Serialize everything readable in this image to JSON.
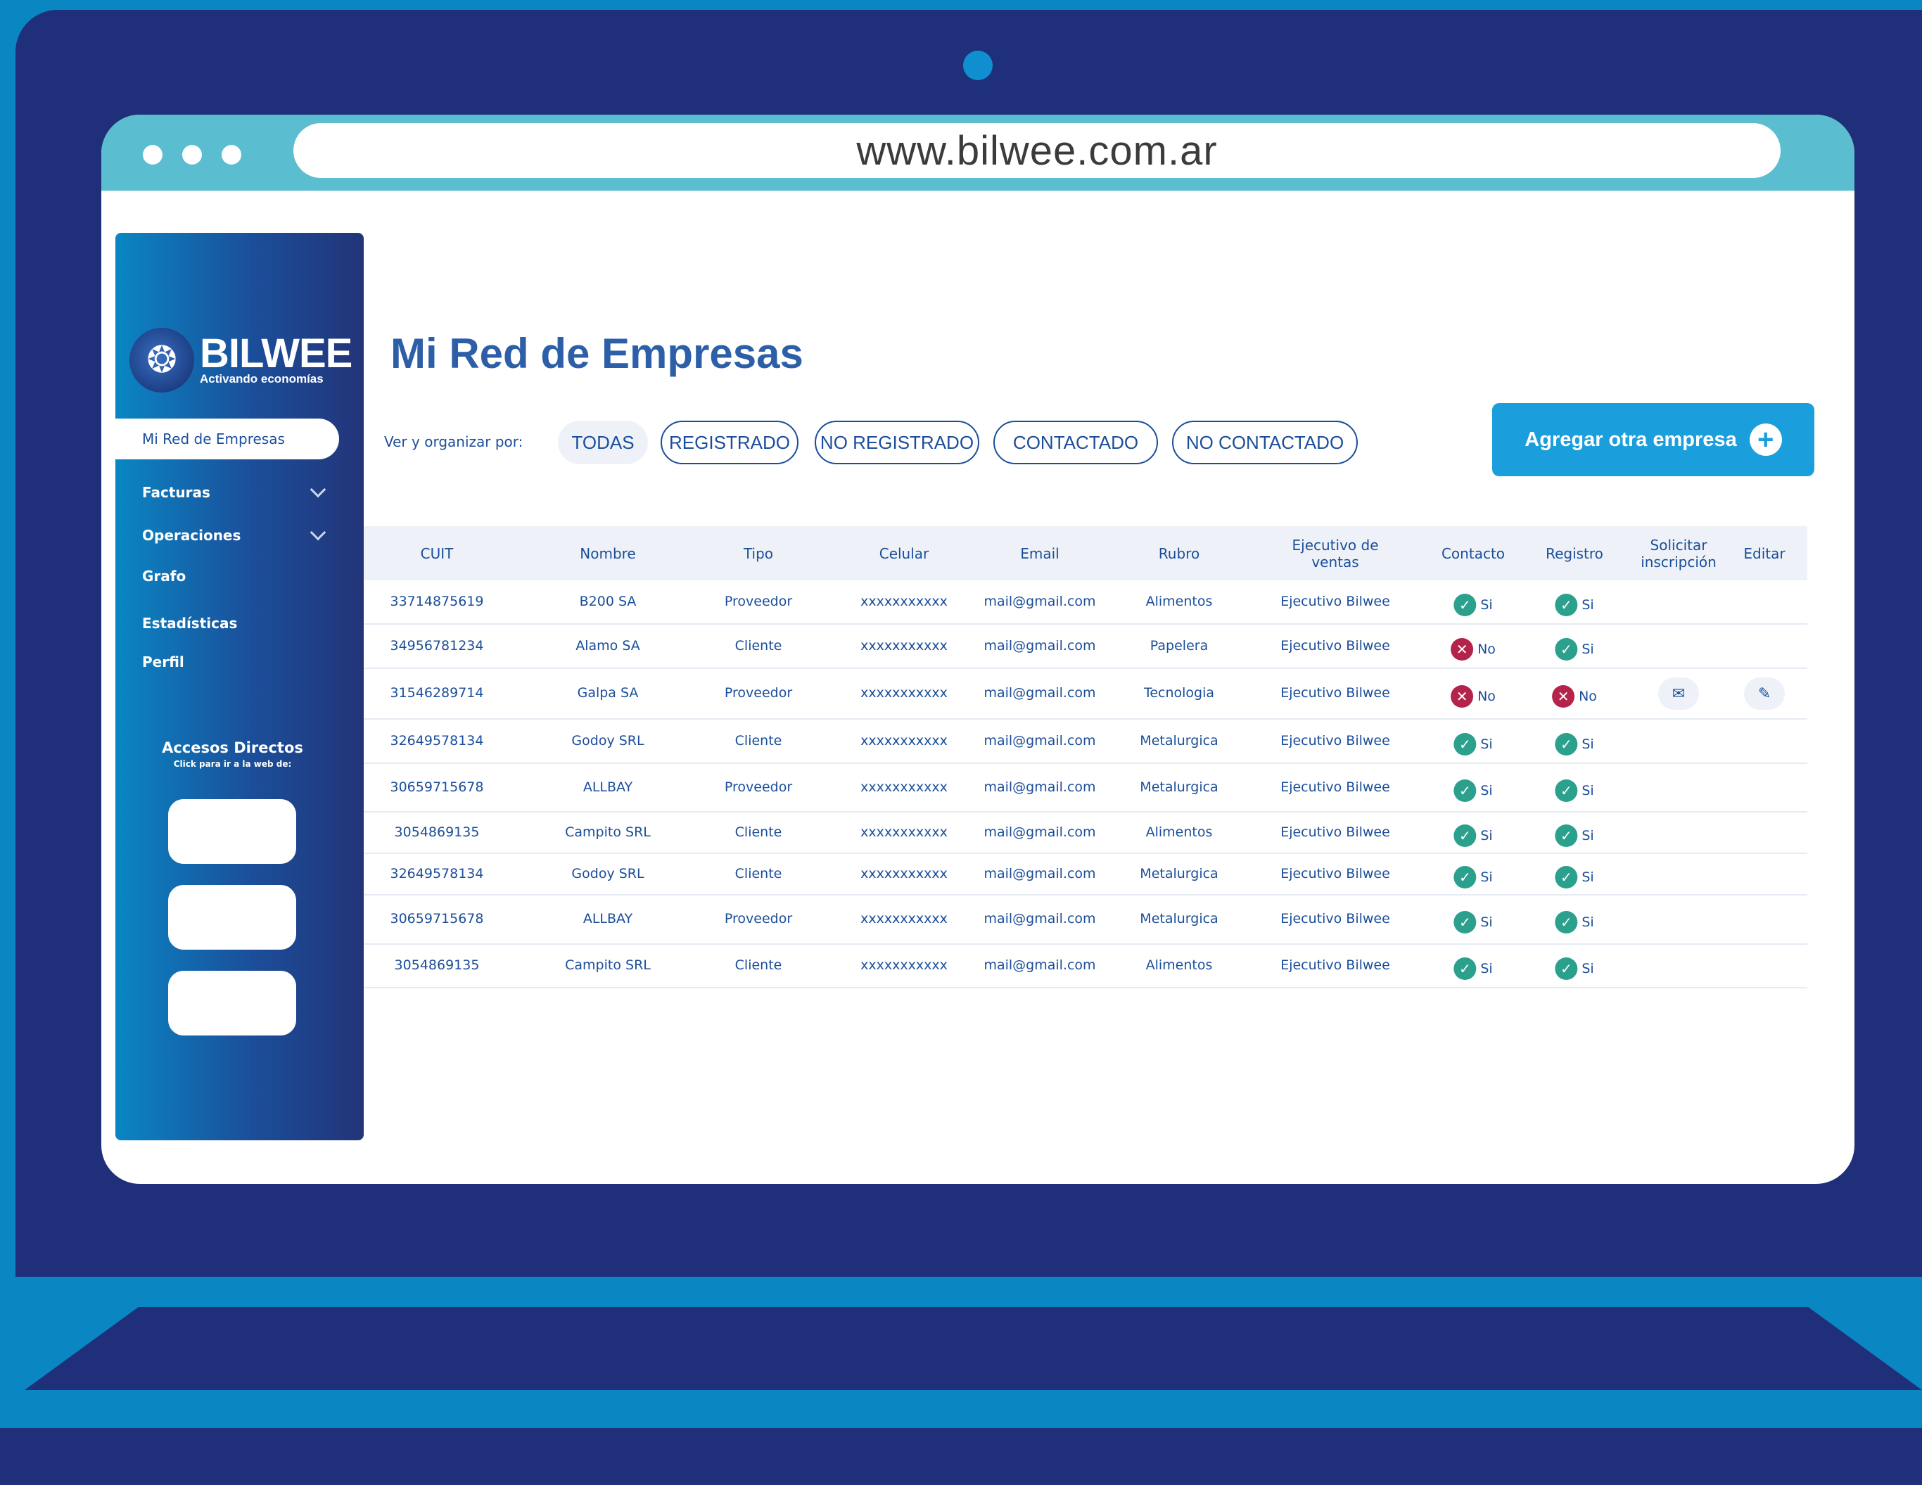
{
  "browser": {
    "url": "www.bilwee.com.ar"
  },
  "sidebar": {
    "logo_title": "BILWEE",
    "logo_subtitle": "Activando economías",
    "items": [
      {
        "label": "Mi Red de Empresas"
      },
      {
        "label": "Facturas"
      },
      {
        "label": "Operaciones"
      },
      {
        "label": "Grafo"
      },
      {
        "label": "Estadísticas"
      },
      {
        "label": "Perfil"
      }
    ],
    "accesos_title": "Accesos Directos",
    "accesos_subtitle": "Click para ir a la web de:"
  },
  "main": {
    "title": "Mi Red de Empresas",
    "filter_label": "Ver y organizar por:",
    "filters": [
      "TODAS",
      "REGISTRADO",
      "NO REGISTRADO",
      "CONTACTADO",
      "NO CONTACTADO"
    ],
    "add_button": "Agregar otra empresa"
  },
  "table": {
    "headers": [
      "CUIT",
      "Nombre",
      "Tipo",
      "Celular",
      "Email",
      "Rubro",
      "Ejecutivo de ventas",
      "Contacto",
      "Registro",
      "Solicitar inscripción",
      "Editar"
    ],
    "rows": [
      {
        "cuit": "33714875619",
        "nombre": "B200 SA",
        "tipo": "Proveedor",
        "celular": "xxxxxxxxxxx",
        "email": "mail@gmail.com",
        "rubro": "Alimentos",
        "ejecutivo": "Ejecutivo Bilwee",
        "contacto": "Si",
        "contacto_ok": true,
        "registro": "Si",
        "registro_ok": true
      },
      {
        "cuit": "34956781234",
        "nombre": "Alamo SA",
        "tipo": "Cliente",
        "celular": "xxxxxxxxxxx",
        "email": "mail@gmail.com",
        "rubro": "Papelera",
        "ejecutivo": "Ejecutivo Bilwee",
        "contacto": "No",
        "contacto_ok": false,
        "registro": "Si",
        "registro_ok": true
      },
      {
        "cuit": "31546289714",
        "nombre": "Galpa SA",
        "tipo": "Proveedor",
        "celular": "xxxxxxxxxxx",
        "email": "mail@gmail.com",
        "rubro": "Tecnologia",
        "ejecutivo": "Ejecutivo Bilwee",
        "contacto": "No",
        "contacto_ok": false,
        "registro": "No",
        "registro_ok": false,
        "actions": true
      },
      {
        "cuit": "32649578134",
        "nombre": "Godoy SRL",
        "tipo": "Cliente",
        "celular": "xxxxxxxxxxx",
        "email": "mail@gmail.com",
        "rubro": "Metalurgica",
        "ejecutivo": "Ejecutivo Bilwee",
        "contacto": "Si",
        "contacto_ok": true,
        "registro": "Si",
        "registro_ok": true
      },
      {
        "cuit": "30659715678",
        "nombre": "ALLBAY",
        "tipo": "Proveedor",
        "celular": "xxxxxxxxxxx",
        "email": "mail@gmail.com",
        "rubro": "Metalurgica",
        "ejecutivo": "Ejecutivo Bilwee",
        "contacto": "Si",
        "contacto_ok": true,
        "registro": "Si",
        "registro_ok": true
      },
      {
        "cuit": "3054869135",
        "nombre": "Campito SRL",
        "tipo": "Cliente",
        "celular": "xxxxxxxxxxx",
        "email": "mail@gmail.com",
        "rubro": "Alimentos",
        "ejecutivo": "Ejecutivo Bilwee",
        "contacto": "Si",
        "contacto_ok": true,
        "registro": "Si",
        "registro_ok": true
      },
      {
        "cuit": "32649578134",
        "nombre": "Godoy SRL",
        "tipo": "Cliente",
        "celular": "xxxxxxxxxxx",
        "email": "mail@gmail.com",
        "rubro": "Metalurgica",
        "ejecutivo": "Ejecutivo Bilwee",
        "contacto": "Si",
        "contacto_ok": true,
        "registro": "Si",
        "registro_ok": true
      },
      {
        "cuit": "30659715678",
        "nombre": "ALLBAY",
        "tipo": "Proveedor",
        "celular": "xxxxxxxxxxx",
        "email": "mail@gmail.com",
        "rubro": "Metalurgica",
        "ejecutivo": "Ejecutivo Bilwee",
        "contacto": "Si",
        "contacto_ok": true,
        "registro": "Si",
        "registro_ok": true
      },
      {
        "cuit": "3054869135",
        "nombre": "Campito SRL",
        "tipo": "Cliente",
        "celular": "xxxxxxxxxxx",
        "email": "mail@gmail.com",
        "rubro": "Alimentos",
        "ejecutivo": "Ejecutivo Bilwee",
        "contacto": "Si",
        "contacto_ok": true,
        "registro": "Si",
        "registro_ok": true
      }
    ]
  },
  "colors": {
    "brand_dark": "#1f2f7a",
    "brand_blue": "#0a86c3",
    "accent_button": "#1a9fdc",
    "status_ok": "#2ba08c",
    "status_error": "#b4234a"
  }
}
